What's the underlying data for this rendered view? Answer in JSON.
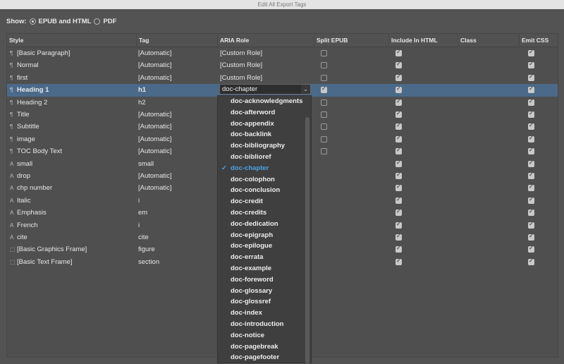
{
  "window": {
    "title": "Edit All Export Tags"
  },
  "show": {
    "label": "Show:",
    "options": [
      {
        "label": "EPUB and HTML",
        "selected": true
      },
      {
        "label": "PDF",
        "selected": false
      }
    ]
  },
  "columns": [
    "Style",
    "Tag",
    "ARIA Role",
    "Split EPUB",
    "Include In HTML",
    "Class",
    "Emit CSS"
  ],
  "rows": [
    {
      "icon": "paragraph-style-icon",
      "name": "[Basic Paragraph]",
      "tag": "[Automatic]",
      "aria": "[Custom Role]",
      "split": false,
      "include": true,
      "emit": true
    },
    {
      "icon": "paragraph-style-icon",
      "name": "Normal",
      "tag": "[Automatic]",
      "aria": "[Custom Role]",
      "split": false,
      "include": true,
      "emit": true
    },
    {
      "icon": "paragraph-style-icon",
      "name": "first",
      "tag": "[Automatic]",
      "aria": "[Custom Role]",
      "split": false,
      "include": true,
      "emit": true
    },
    {
      "icon": "paragraph-style-icon",
      "name": "Heading 1",
      "tag": "h1",
      "aria": "doc-chapter",
      "split": true,
      "include": true,
      "emit": true,
      "selected": true
    },
    {
      "icon": "paragraph-style-icon",
      "name": "Heading 2",
      "tag": "h2",
      "split": false,
      "include": true,
      "emit": true
    },
    {
      "icon": "paragraph-style-icon",
      "name": "Title",
      "tag": "[Automatic]",
      "split": false,
      "include": true,
      "emit": true
    },
    {
      "icon": "paragraph-style-icon",
      "name": "Subtitle",
      "tag": "[Automatic]",
      "split": false,
      "include": true,
      "emit": true
    },
    {
      "icon": "paragraph-style-icon",
      "name": "image",
      "tag": "[Automatic]",
      "split": false,
      "include": true,
      "emit": true
    },
    {
      "icon": "paragraph-style-icon",
      "name": "TOC Body Text",
      "tag": "[Automatic]",
      "split": false,
      "include": true,
      "emit": true
    },
    {
      "icon": "character-style-icon",
      "name": "small",
      "tag": "small",
      "include": true,
      "emit": true
    },
    {
      "icon": "character-style-icon",
      "name": "drop",
      "tag": "[Automatic]",
      "include": true,
      "emit": true
    },
    {
      "icon": "character-style-icon",
      "name": "chp number",
      "tag": "[Automatic]",
      "include": true,
      "emit": true
    },
    {
      "icon": "character-style-icon",
      "name": "Italic",
      "tag": "i",
      "include": true,
      "emit": true
    },
    {
      "icon": "character-style-icon",
      "name": "Emphasis",
      "tag": "em",
      "include": true,
      "emit": true
    },
    {
      "icon": "character-style-icon",
      "name": "French",
      "tag": "i",
      "include": true,
      "emit": true
    },
    {
      "icon": "character-style-icon",
      "name": "cite",
      "tag": "cite",
      "include": true,
      "emit": true
    },
    {
      "icon": "object-style-icon",
      "name": "[Basic Graphics Frame]",
      "tag": "figure",
      "include": true,
      "emit": true
    },
    {
      "icon": "object-style-icon",
      "name": "[Basic Text Frame]",
      "tag": "section",
      "include": true,
      "emit": true
    }
  ],
  "aria_dropdown": {
    "selected": "doc-chapter",
    "options": [
      "doc-acknowledgments",
      "doc-afterword",
      "doc-appendix",
      "doc-backlink",
      "doc-bibliography",
      "doc-biblioref",
      "doc-chapter",
      "doc-colophon",
      "doc-conclusion",
      "doc-credit",
      "doc-credits",
      "doc-dedication",
      "doc-epigraph",
      "doc-epilogue",
      "doc-errata",
      "doc-example",
      "doc-foreword",
      "doc-glossary",
      "doc-glossref",
      "doc-index",
      "doc-introduction",
      "doc-notice",
      "doc-pagebreak",
      "doc-pagefooter"
    ]
  }
}
